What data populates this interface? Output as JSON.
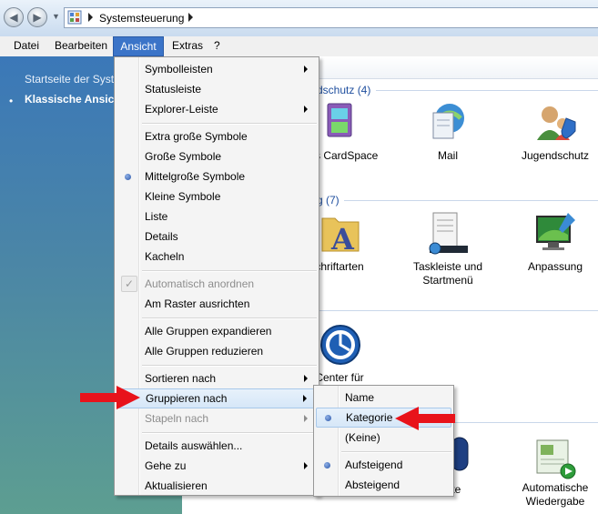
{
  "address_bar": {
    "breadcrumb": "Systemsteuerung",
    "back_icon": "back-arrow-icon",
    "forward_icon": "forward-arrow-icon"
  },
  "menubar": {
    "items": [
      "Datei",
      "Bearbeiten",
      "Ansicht",
      "Extras",
      "?"
    ],
    "active": "Ansicht"
  },
  "left_panel": {
    "links": [
      "Startseite der Systemsteuerung",
      "Klassische Ansicht"
    ],
    "selected": "Klassische Ansicht"
  },
  "content": {
    "group_headers": [
      "dschutz (4)",
      "g (7)"
    ],
    "items": [
      {
        "label": "ows CardSpace",
        "icon": "cardspace-icon"
      },
      {
        "label": "Mail",
        "icon": "mail-icon"
      },
      {
        "label": "Jugendschutz",
        "icon": "parental-controls-icon"
      },
      {
        "label": "chriftarten",
        "icon": "fonts-folder-icon"
      },
      {
        "label": "Taskleiste und Startmenü",
        "icon": "taskbar-icon"
      },
      {
        "label": "Anpassung",
        "icon": "personalization-icon"
      },
      {
        "label": "Center für",
        "icon": "ease-of-access-icon"
      },
      {
        "label": "-Geräte",
        "icon": "devices-icon"
      },
      {
        "label": "Automatische Wiedergabe",
        "icon": "autoplay-icon"
      }
    ]
  },
  "ansicht_menu": {
    "items": [
      {
        "label": "Symbolleisten",
        "submenu": true
      },
      {
        "label": "Statusleiste"
      },
      {
        "label": "Explorer-Leiste",
        "submenu": true
      },
      {
        "label": "Extra große Symbole"
      },
      {
        "label": "Große Symbole"
      },
      {
        "label": "Mittelgroße Symbole",
        "selected": true
      },
      {
        "label": "Kleine Symbole"
      },
      {
        "label": "Liste"
      },
      {
        "label": "Details"
      },
      {
        "label": "Kacheln"
      },
      {
        "label": "Automatisch anordnen",
        "disabled": true,
        "checked": true
      },
      {
        "label": "Am Raster ausrichten"
      },
      {
        "label": "Alle Gruppen expandieren"
      },
      {
        "label": "Alle Gruppen reduzieren"
      },
      {
        "label": "Sortieren nach",
        "submenu": true
      },
      {
        "label": "Gruppieren nach",
        "submenu": true,
        "highlighted": true
      },
      {
        "label": "Stapeln nach",
        "submenu": true,
        "disabled": true
      },
      {
        "label": "Details auswählen..."
      },
      {
        "label": "Gehe zu",
        "submenu": true
      },
      {
        "label": "Aktualisieren"
      }
    ]
  },
  "gruppieren_submenu": {
    "items": [
      {
        "label": "Name"
      },
      {
        "label": "Kategorie",
        "selected": true,
        "highlighted": true
      },
      {
        "label": "(Keine)"
      },
      {
        "label": "Aufsteigend",
        "selected": true
      },
      {
        "label": "Absteigend"
      }
    ]
  },
  "annotation_color": "#e8131b"
}
